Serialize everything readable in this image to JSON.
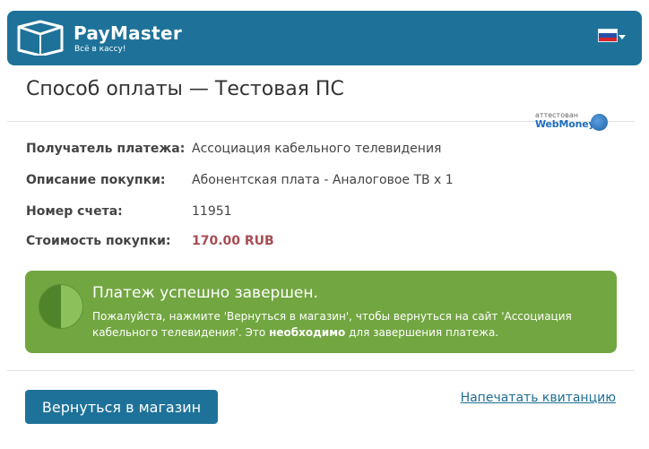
{
  "header": {
    "brand": "PayMaster",
    "slogan": "Всё в кассу!",
    "language": "ru"
  },
  "page": {
    "title": "Способ оплаты — Тестовая ПС"
  },
  "certificate": {
    "small_text": "аттестован",
    "brand_text": "WebMoney"
  },
  "details": {
    "recipient_label": "Получатель платежа:",
    "recipient_value": "Ассоциация кабельного телевидения",
    "description_label": "Описание покупки:",
    "description_value": "Абонентская плата - Аналоговое ТВ х 1",
    "invoice_label": "Номер счета:",
    "invoice_value": "11951",
    "cost_label": "Стоимость покупки:",
    "cost_value": "170.00 RUB"
  },
  "success": {
    "title": "Платеж успешно завершен.",
    "text_before": "Пожалуйста, нажмите 'Вернуться в магазин', чтобы вернуться на сайт 'Ассоциация кабельного телевидения'. Это ",
    "text_bold": "необходимо",
    "text_after": " для завершения платежа."
  },
  "actions": {
    "return_label": "Вернуться в магазин",
    "print_label": "Напечатать квитанцию"
  },
  "colors": {
    "header_bg": "#1e7299",
    "success_bg": "#72a641",
    "price": "#a64d55",
    "link": "#1e6e94"
  }
}
